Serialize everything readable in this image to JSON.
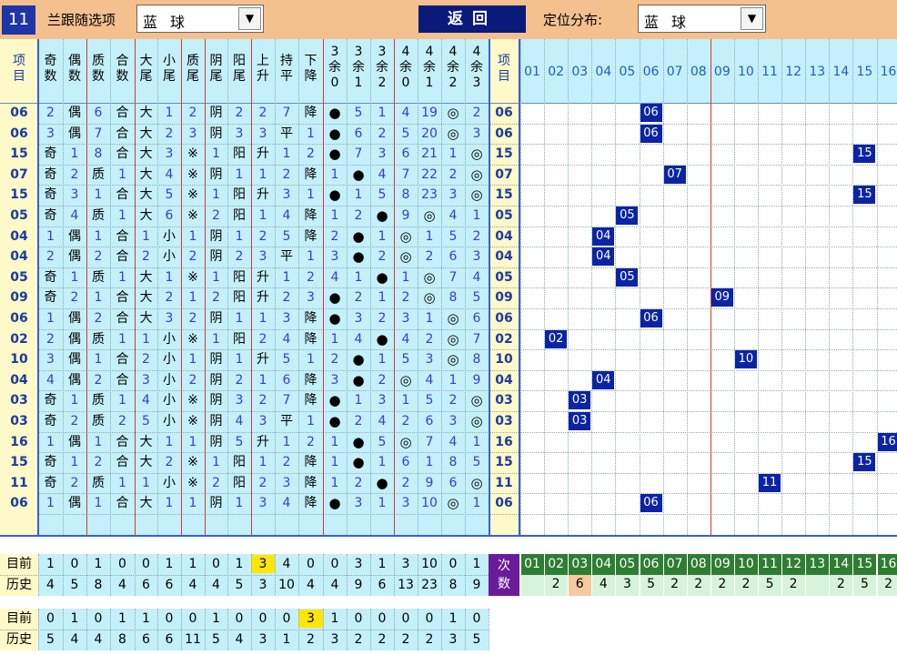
{
  "top": {
    "issue": "11",
    "follow_label": "兰跟随选项",
    "follow_value": "蓝球",
    "back_label": "返回",
    "dist_label": "定位分布:",
    "dist_value": "蓝球",
    "arrow": "▼"
  },
  "headers": {
    "item": "项目",
    "cols": [
      "奇数",
      "偶数",
      "质数",
      "合数",
      "大尾",
      "小尾",
      "质尾",
      "阴尾",
      "阳尾",
      "上升",
      "持平",
      "下降",
      "3余0",
      "3余1",
      "3余2",
      "4余0",
      "4余1",
      "4余2",
      "4余3"
    ],
    "positions": [
      "01",
      "02",
      "03",
      "04",
      "05",
      "06",
      "07",
      "08",
      "09",
      "10",
      "11",
      "12",
      "13",
      "14",
      "15",
      "16"
    ]
  },
  "rows": [
    {
      "n": "06",
      "c": [
        "2",
        "偶",
        "6",
        "合",
        "大",
        "1",
        "2",
        "阴",
        "2",
        "2",
        "7",
        "降",
        "●",
        "5",
        "1",
        "4",
        "19",
        "◎",
        "2"
      ]
    },
    {
      "n": "06",
      "c": [
        "3",
        "偶",
        "7",
        "合",
        "大",
        "2",
        "3",
        "阴",
        "3",
        "3",
        "平",
        "1",
        "●",
        "6",
        "2",
        "5",
        "20",
        "◎",
        "3"
      ]
    },
    {
      "n": "15",
      "c": [
        "奇",
        "1",
        "8",
        "合",
        "大",
        "3",
        "※",
        "1",
        "阳",
        "升",
        "1",
        "2",
        "●",
        "7",
        "3",
        "6",
        "21",
        "1",
        "◎"
      ]
    },
    {
      "n": "07",
      "c": [
        "奇",
        "2",
        "质",
        "1",
        "大",
        "4",
        "※",
        "阴",
        "1",
        "1",
        "2",
        "降",
        "1",
        "●",
        "4",
        "7",
        "22",
        "2",
        "◎"
      ]
    },
    {
      "n": "15",
      "c": [
        "奇",
        "3",
        "1",
        "合",
        "大",
        "5",
        "※",
        "1",
        "阳",
        "升",
        "3",
        "1",
        "●",
        "1",
        "5",
        "8",
        "23",
        "3",
        "◎"
      ]
    },
    {
      "n": "05",
      "c": [
        "奇",
        "4",
        "质",
        "1",
        "大",
        "6",
        "※",
        "2",
        "阳",
        "1",
        "4",
        "降",
        "1",
        "2",
        "●",
        "9",
        "◎",
        "4",
        "1"
      ]
    },
    {
      "n": "04",
      "c": [
        "1",
        "偶",
        "1",
        "合",
        "1",
        "小",
        "1",
        "阴",
        "1",
        "2",
        "5",
        "降",
        "2",
        "●",
        "1",
        "◎",
        "1",
        "5",
        "2"
      ]
    },
    {
      "n": "04",
      "c": [
        "2",
        "偶",
        "2",
        "合",
        "2",
        "小",
        "2",
        "阴",
        "2",
        "3",
        "平",
        "1",
        "3",
        "●",
        "2",
        "◎",
        "2",
        "6",
        "3"
      ]
    },
    {
      "n": "05",
      "c": [
        "奇",
        "1",
        "质",
        "1",
        "大",
        "1",
        "※",
        "1",
        "阳",
        "升",
        "1",
        "2",
        "4",
        "1",
        "●",
        "1",
        "◎",
        "7",
        "4"
      ]
    },
    {
      "n": "09",
      "c": [
        "奇",
        "2",
        "1",
        "合",
        "大",
        "2",
        "1",
        "2",
        "阳",
        "升",
        "2",
        "3",
        "●",
        "2",
        "1",
        "2",
        "◎",
        "8",
        "5"
      ]
    },
    {
      "n": "06",
      "c": [
        "1",
        "偶",
        "2",
        "合",
        "大",
        "3",
        "2",
        "阴",
        "1",
        "1",
        "3",
        "降",
        "●",
        "3",
        "2",
        "3",
        "1",
        "◎",
        "6"
      ]
    },
    {
      "n": "02",
      "c": [
        "2",
        "偶",
        "质",
        "1",
        "1",
        "小",
        "※",
        "1",
        "阳",
        "2",
        "4",
        "降",
        "1",
        "4",
        "●",
        "4",
        "2",
        "◎",
        "7"
      ]
    },
    {
      "n": "10",
      "c": [
        "3",
        "偶",
        "1",
        "合",
        "2",
        "小",
        "1",
        "阴",
        "1",
        "升",
        "5",
        "1",
        "2",
        "●",
        "1",
        "5",
        "3",
        "◎",
        "8"
      ]
    },
    {
      "n": "04",
      "c": [
        "4",
        "偶",
        "2",
        "合",
        "3",
        "小",
        "2",
        "阴",
        "2",
        "1",
        "6",
        "降",
        "3",
        "●",
        "2",
        "◎",
        "4",
        "1",
        "9"
      ]
    },
    {
      "n": "03",
      "c": [
        "奇",
        "1",
        "质",
        "1",
        "4",
        "小",
        "※",
        "阴",
        "3",
        "2",
        "7",
        "降",
        "●",
        "1",
        "3",
        "1",
        "5",
        "2",
        "◎"
      ]
    },
    {
      "n": "03",
      "c": [
        "奇",
        "2",
        "质",
        "2",
        "5",
        "小",
        "※",
        "阴",
        "4",
        "3",
        "平",
        "1",
        "●",
        "2",
        "4",
        "2",
        "6",
        "3",
        "◎"
      ]
    },
    {
      "n": "16",
      "c": [
        "1",
        "偶",
        "1",
        "合",
        "大",
        "1",
        "1",
        "阴",
        "5",
        "升",
        "1",
        "2",
        "1",
        "●",
        "5",
        "◎",
        "7",
        "4",
        "1"
      ]
    },
    {
      "n": "15",
      "c": [
        "奇",
        "1",
        "2",
        "合",
        "大",
        "2",
        "※",
        "1",
        "阳",
        "1",
        "2",
        "降",
        "1",
        "●",
        "1",
        "6",
        "1",
        "8",
        "5"
      ]
    },
    {
      "n": "11",
      "c": [
        "奇",
        "2",
        "质",
        "1",
        "1",
        "小",
        "※",
        "2",
        "阳",
        "2",
        "3",
        "降",
        "1",
        "2",
        "●",
        "2",
        "9",
        "6",
        "◎"
      ]
    },
    {
      "n": "06",
      "c": [
        "1",
        "偶",
        "1",
        "合",
        "大",
        "1",
        "1",
        "阴",
        "1",
        "3",
        "4",
        "降",
        "●",
        "3",
        "1",
        "3",
        "10",
        "◎",
        "1"
      ]
    }
  ],
  "stats": {
    "cur_label": "目前",
    "hist_label": "历史",
    "cur": [
      "1",
      "0",
      "1",
      "0",
      "0",
      "1",
      "1",
      "0",
      "1",
      "3",
      "4",
      "0",
      "0",
      "3",
      "1",
      "3",
      "10",
      "0",
      "1"
    ],
    "hist": [
      "4",
      "5",
      "8",
      "4",
      "6",
      "6",
      "4",
      "4",
      "5",
      "3",
      "10",
      "4",
      "4",
      "9",
      "6",
      "13",
      "23",
      "8",
      "9"
    ],
    "count_label": "次数",
    "count_positions": [
      "01",
      "02",
      "03",
      "04",
      "05",
      "06",
      "07",
      "08",
      "09",
      "10",
      "11",
      "12",
      "13",
      "14",
      "15",
      "16"
    ],
    "counts": [
      "",
      "2",
      "6",
      "4",
      "3",
      "5",
      "2",
      "2",
      "2",
      "2",
      "5",
      "2",
      "",
      "2",
      "5",
      "2"
    ]
  },
  "stats2": {
    "cur_label": "目前",
    "hist_label": "历史",
    "cur": [
      "0",
      "1",
      "0",
      "1",
      "1",
      "0",
      "0",
      "1",
      "0",
      "0",
      "0",
      "3",
      "1",
      "0",
      "0",
      "0",
      "0",
      "1",
      "0"
    ],
    "hist": [
      "5",
      "4",
      "4",
      "8",
      "6",
      "6",
      "11",
      "5",
      "4",
      "3",
      "1",
      "2",
      "3",
      "2",
      "2",
      "2",
      "2",
      "3",
      "5"
    ]
  },
  "colors": {
    "top": "#f3c08e",
    "lightblue": "#c4f0fb",
    "yellow": "#fdf9c8",
    "navy": "#0b24a6",
    "green": "#2e7d32",
    "purple": "#6a1b9a"
  }
}
